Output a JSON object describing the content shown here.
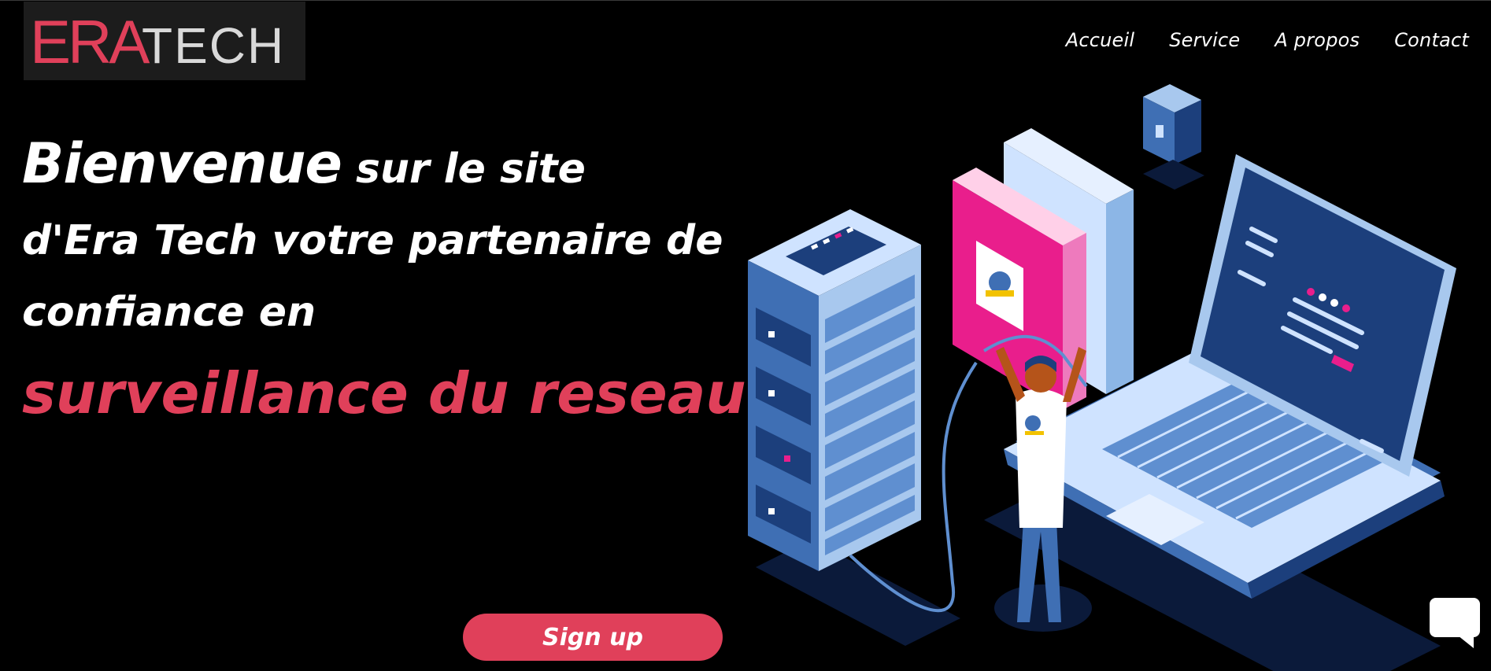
{
  "brand": {
    "logo_part1": "ERA",
    "logo_part2": "TECH",
    "accent_color": "#e0405a"
  },
  "nav": {
    "items": [
      "Accueil",
      "Service",
      "A propos",
      "Contact"
    ]
  },
  "hero": {
    "word1": "Bienvenue",
    "line1_rest": " sur le site",
    "line2": "d'Era Tech votre partenaire de",
    "line3": "confiance en",
    "typed": "surveillance du reseau"
  },
  "cta": {
    "label": "Sign up"
  },
  "widgets": {
    "chat_icon": "chat-bubble-icon"
  }
}
